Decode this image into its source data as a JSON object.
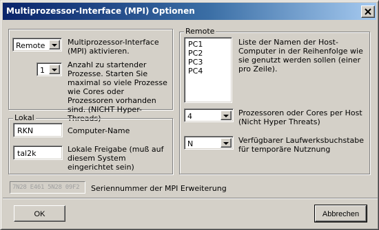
{
  "window": {
    "title": "Multiprozessor-Interface (MPI) Optionen",
    "close_icon": "close-x-icon"
  },
  "mpi": {
    "mode_value": "Remote",
    "mode_label": "Multiprozessor-Interface (MPI) aktivieren.",
    "process_count_value": "1",
    "process_count_label": "Anzahl zu startender Prozesse. Starten Sie maximal so viele Prozesse wie Cores oder Prozessoren vorhanden sind. (NICHT Hyper-Threads)"
  },
  "lokal": {
    "group_label": "Lokal",
    "computer_name_value": "RKN",
    "computer_name_label": "Computer-Name",
    "share_value": "tal2k",
    "share_label": "Lokale Freigabe (muß auf diesem System eingerichtet sein)"
  },
  "remote": {
    "group_label": "Remote",
    "hosts": [
      "PC1",
      "PC2",
      "PC3",
      "PC4"
    ],
    "hosts_label": "Liste der Namen der Host-Computer in der Reihenfolge wie sie genutzt werden sollen (einer pro Zeile).",
    "cores_value": "4",
    "cores_label": "Prozessoren oder Cores per Host (Nicht Hyper Threats)",
    "drive_value": "N",
    "drive_label": "Verfügbarer Laufwerksbuchstabe für temporäre Nutznung"
  },
  "serial": {
    "value": "7N28 E461 5N28 09F2",
    "label": "Seriennummer der MPI Erweiterung"
  },
  "buttons": {
    "ok": "OK",
    "cancel": "Abbrechen"
  },
  "colors": {
    "title_gradient_start": "#0a246a",
    "title_gradient_end": "#a6caf0",
    "face": "#d4d0c8"
  }
}
